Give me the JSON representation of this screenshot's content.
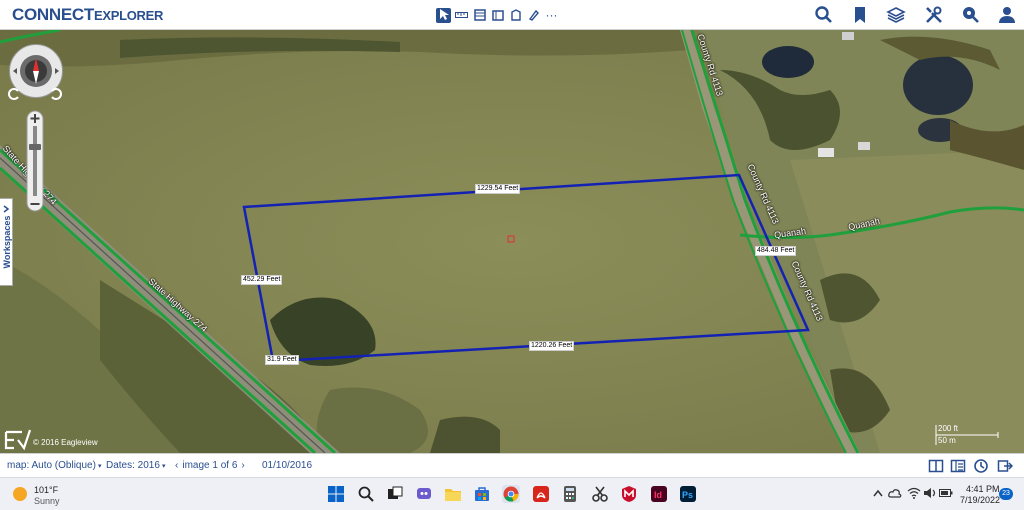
{
  "app": {
    "logo_main": "CONNECT",
    "logo_second": "EXPLORER"
  },
  "header_tools": {
    "select_icon": "pointer-icon",
    "measure_icon": "ruler-icon",
    "more": "···"
  },
  "map": {
    "measurements": {
      "north": "1229.54 Feet",
      "east": "484.48 Feet",
      "south": "1220.26 Feet",
      "west": "452.29 Feet",
      "southwest": "31.9 Feet"
    },
    "road_labels": {
      "county_rd_north": "County Rd 4113",
      "county_rd_south": "County Rd 4113",
      "county_rd_far": "County Rd 4113",
      "quanah_1": "Quanah",
      "quanah_2": "Quanah",
      "highway_north": "State Highway 274",
      "highway_south": "State Highway 274"
    },
    "copyright": "© 2016 Eagleview",
    "scale_ft": "200 ft",
    "scale_m": "50 m",
    "workspaces_label": "Workspaces"
  },
  "footer": {
    "map_mode": "map: Auto (Oblique)",
    "dates": "Dates: 2016",
    "image_counter": "image 1 of 6",
    "date_value": "01/10/2016"
  },
  "taskbar": {
    "weather_temp": "101°F",
    "weather_desc": "Sunny",
    "time": "4:41 PM",
    "date": "7/19/2022",
    "notification_count": "23"
  }
}
